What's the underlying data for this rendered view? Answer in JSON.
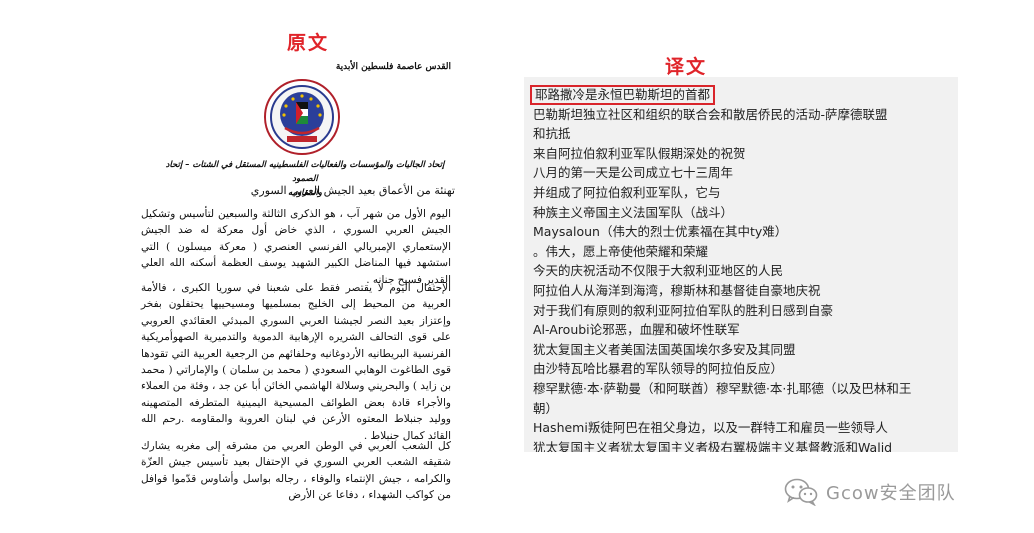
{
  "orig_title": "原文",
  "trans_title": "译文",
  "original": {
    "header": "القدس عاصمة فلسطين الأبدية",
    "subtitle_line1": "إتحاد الجاليات والمؤسسات والفعاليات الفلسطينيه المستقل في الشتات – إتحاد الصمود",
    "subtitle_line2": "والمقاومه",
    "greeting": "تهنئة من الأعماق بعيد الجيش العربي السوري",
    "para1": "اليوم الأول من شهر آب ، هو الذكرى الثالثة والسبعين لتأسيس وتشكيل الجيش العربي السوري ، الذي خاض أول معركة له ضد الجيش الإستعماري الإمبريالي الفرنسي العنصري ( معركة ميسلون ) التي استشهد فيها المناضل الكبير الشهيد يوسف العظمة أسكنه الله العلي القدير فسيح جنانه .",
    "para2": "الإحتفال اليوم لا يقتصر فقط على شعبنا في سوريا الكبرى ، فالأمة العربية من المحيط إلى الخليج بمسلميها ومسيحييها يحتفلون بفخر وإعتزاز بعيد النصر لجيشنا العربي السوري المبدئي العقائدي العروبي على قوى التحالف الشريره الإرهابية الدموية والتدميرية الصهوأمريكية الفرنسية البريطانيه الأردوغانيه وحلفائهم من الرجعية العربية التي تقودها قوى الطاغوت الوهابي السعودي ( محمد بن سلمان ) والإماراتي ( محمد بن زايد ) والبحريني وسلالة الهاشمي الخائن أبا عن جد ، وفئة من العملاء والأجراء قادة بعض الطوائف المسيحية اليمينية المتطرفه المتصهينه ووليد جنبلاط المعتوه الأرعن في لبنان العروبة والمقاومه .رحم الله القائد كمال جنبلاط .",
    "para3": "كل الشعب العربي في الوطن العربي من مشرقه إلى مغربه يشارك شقيقه الشعب العربي السوري في الإحتفال بعيد تأسيس جيش العزّة والكرامه ، جيش الإنتماء والوفاء ، رجاله بواسل وأشاوس قدّموا قوافل من كواكب الشهداء ، دفاعا عن الأرض"
  },
  "translation": {
    "lines": [
      "耶路撒冷是永恒巴勒斯坦的首都",
      "巴勒斯坦独立社区和组织的联合会和散居侨民的活动-萨摩德联盟",
      "和抗抵",
      "来自阿拉伯叙利亚军队假期深处的祝贺",
      "八月的第一天是公司成立七十三周年",
      "并组成了阿拉伯叙利亚军队，它与",
      "种族主义帝国主义法国军队（战斗）",
      "Maysaloun（伟大的烈士优素福在其中ty难）",
      "。伟大，愿上帝使他荣耀和荣耀",
      "今天的庆祝活动不仅限于大叙利亚地区的人民",
      "阿拉伯人从海洋到海湾，穆斯林和基督徒自豪地庆祝",
      "对于我们有原则的叙利亚阿拉伯军队的胜利日感到自豪",
      "Al-Aroubi论邪恶，血腥和破坏性联军",
      "犹太复国主义者美国法国英国埃尔多安及其同盟",
      "由沙特瓦哈比暴君的军队领导的阿拉伯反应）",
      "穆罕默德·本·萨勒曼（和阿联酋）穆罕默德·本·扎耶德（以及巴林和王",
      "朝）",
      "Hashemi叛徒阿巴在祖父身边，以及一群特工和雇员一些领导人",
      "犹太复国主义者犹太复国主义者极右翼极端主义基督教派和Walid"
    ]
  },
  "watermark": {
    "text": "Gcow安全团队",
    "icon": "wechat-icon"
  },
  "colors": {
    "title_red": "#e0242a",
    "highlight_border": "#d9252b",
    "panel_bg": "#f1f1f1",
    "watermark_gray": "#9a9a9a"
  }
}
